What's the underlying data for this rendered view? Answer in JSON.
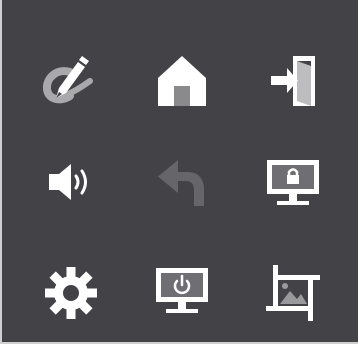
{
  "panel": {
    "background": "#434347",
    "icon_color": "#ffffff",
    "disabled_icon_color": "#66666a",
    "grid_line_color": "#cfcfcf"
  },
  "buttons": [
    {
      "icon": "edit-signature-icon",
      "enabled": true
    },
    {
      "icon": "home-icon",
      "enabled": true
    },
    {
      "icon": "sign-in-icon",
      "enabled": true
    },
    {
      "icon": "volume-icon",
      "enabled": true
    },
    {
      "icon": "undo-icon",
      "enabled": false
    },
    {
      "icon": "lock-screen-icon",
      "enabled": true
    },
    {
      "icon": "settings-gear-icon",
      "enabled": true
    },
    {
      "icon": "power-monitor-icon",
      "enabled": true
    },
    {
      "icon": "crop-image-icon",
      "enabled": true
    }
  ]
}
